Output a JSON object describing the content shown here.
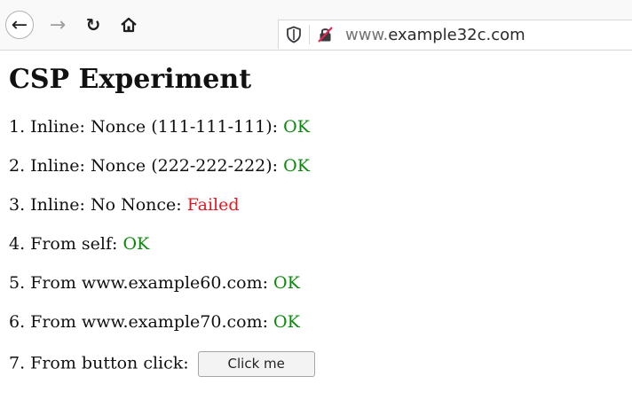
{
  "browser": {
    "url_prefix": "www.",
    "url_domain": "example32c.com",
    "icons": [
      "back-arrow-icon",
      "forward-arrow-icon",
      "reload-icon",
      "home-icon",
      "shield-icon",
      "insecure-lock-icon"
    ]
  },
  "page": {
    "title": "CSP Experiment",
    "items": [
      {
        "label": "1. Inline: Nonce (111-111-111): ",
        "status": "OK"
      },
      {
        "label": "2. Inline: Nonce (222-222-222): ",
        "status": "OK"
      },
      {
        "label": "3. Inline: No Nonce: ",
        "status": "Failed"
      },
      {
        "label": "4. From self: ",
        "status": "OK"
      },
      {
        "label": "5. From www.example60.com: ",
        "status": "OK"
      },
      {
        "label": "6. From www.example70.com: ",
        "status": "OK"
      }
    ],
    "button_item": {
      "label": "7. From button click: ",
      "button_label": "Click me"
    }
  },
  "colors": {
    "ok": "#0a8a0a",
    "failed": "#e8141e"
  }
}
